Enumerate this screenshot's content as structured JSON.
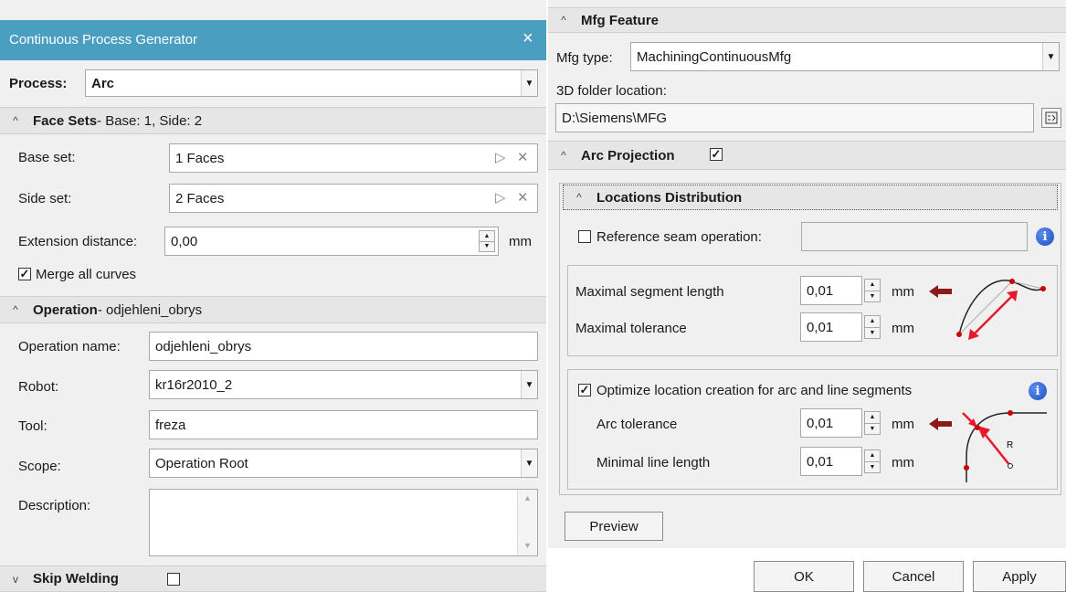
{
  "dialog": {
    "title": "Continuous Process Generator",
    "close_glyph": "×",
    "process_label": "Process:",
    "process_value": "Arc"
  },
  "face_sets": {
    "header": "Face Sets",
    "header_detail": " - Base: 1, Side: 2",
    "base_label": "Base set:",
    "base_value": "1 Faces",
    "side_label": "Side set:",
    "side_value": "2 Faces",
    "pick_glyph": "▷",
    "clear_glyph": "✕",
    "extension_label": "Extension distance:",
    "extension_value": "0,00",
    "extension_unit": "mm",
    "merge_label": "Merge all curves",
    "merge_checked": true
  },
  "operation": {
    "header": "Operation",
    "header_detail": " - odjehleni_obrys",
    "name_label": "Operation name:",
    "name_value": "odjehleni_obrys",
    "robot_label": "Robot:",
    "robot_value": "kr16r2010_2",
    "tool_label": "Tool:",
    "tool_value": "freza",
    "scope_label": "Scope:",
    "scope_value": "Operation Root",
    "description_label": "Description:",
    "description_value": ""
  },
  "skip_welding": {
    "header": "Skip Welding",
    "checked": false
  },
  "mfg_feature": {
    "header": "Mfg Feature",
    "type_label": "Mfg type:",
    "type_value": "MachiningContinuousMfg",
    "folder_label": "3D folder location:",
    "folder_value": "D:\\Siemens\\MFG"
  },
  "arc_projection": {
    "header": "Arc Projection",
    "checked": true
  },
  "locations": {
    "header": "Locations Distribution",
    "ref_seam_label": "Reference seam operation:",
    "ref_seam_checked": false,
    "ref_seam_value": "",
    "max_segment_label": "Maximal segment length",
    "max_segment_value": "0,01",
    "max_tolerance_label": "Maximal tolerance",
    "max_tolerance_value": "0,01",
    "unit": "mm",
    "optimize_label": "Optimize location creation for arc and line segments",
    "optimize_checked": true,
    "arc_tolerance_label": "Arc tolerance",
    "arc_tolerance_value": "0,01",
    "min_line_label": "Minimal line length",
    "min_line_value": "0,01",
    "diagram_radius_label": "R"
  },
  "buttons": {
    "preview": "Preview",
    "ok": "OK",
    "cancel": "Cancel",
    "apply": "Apply"
  },
  "colors": {
    "title_bar": "#4a9fc0",
    "accent_arrow": "#8b1a1a",
    "diagram_red": "#e8192c"
  },
  "icons": {
    "chevron_up": "^",
    "chevron_down": "v",
    "dropdown": "▼",
    "spin_up": "▲",
    "spin_down": "▼",
    "info": "i",
    "browse": "folder-browse-icon"
  }
}
